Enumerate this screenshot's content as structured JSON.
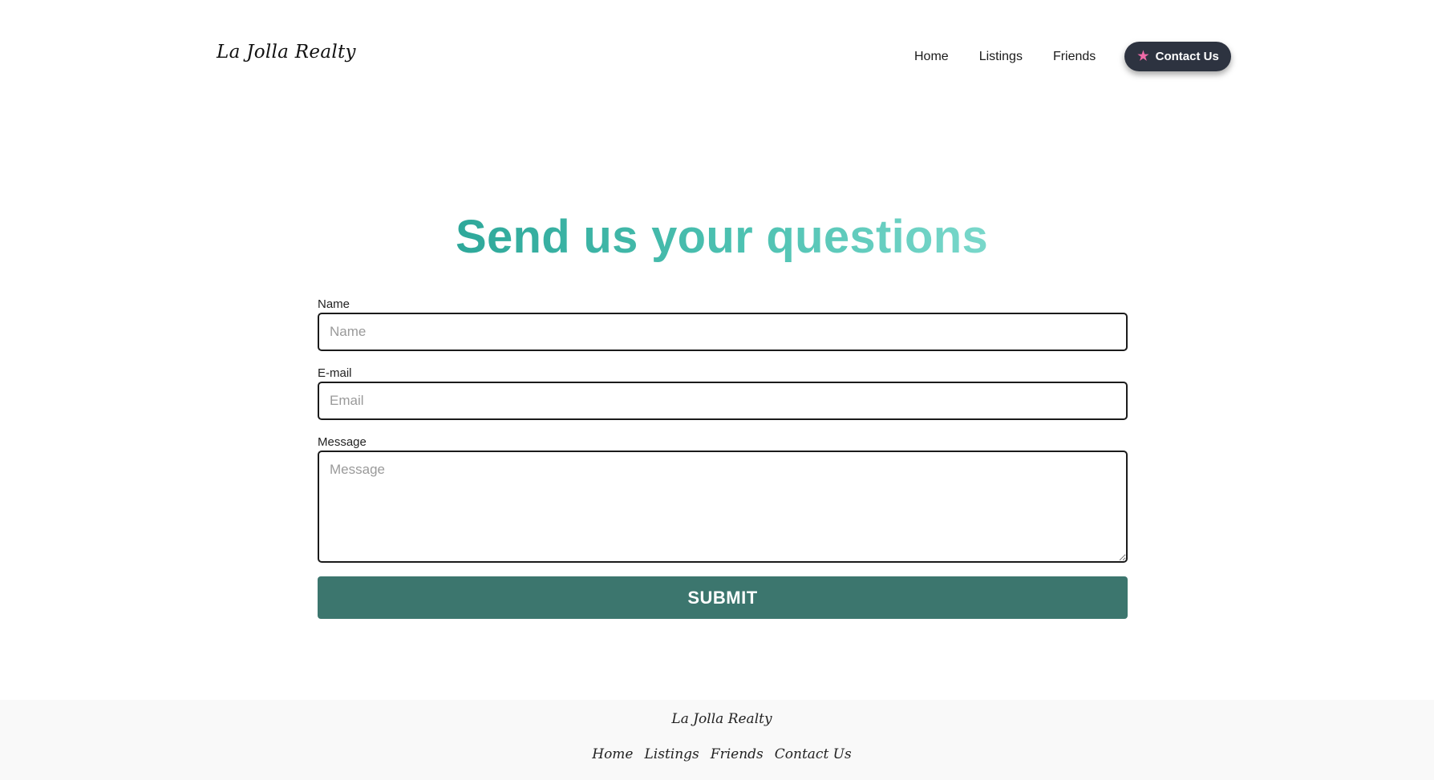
{
  "header": {
    "brand": "La Jolla Realty",
    "nav": [
      "Home",
      "Listings",
      "Friends"
    ],
    "contact_button": {
      "label": "Contact Us",
      "icon": "star-icon",
      "icon_color": "#ee6aa7",
      "background": "#2d3340"
    }
  },
  "hero": {
    "title": "Send us your questions",
    "gradient": [
      "#2ea89a",
      "#7ad8cb"
    ]
  },
  "form": {
    "name": {
      "label": "Name",
      "placeholder": "Name",
      "value": ""
    },
    "email": {
      "label": "E-mail",
      "placeholder": "Email",
      "value": ""
    },
    "message": {
      "label": "Message",
      "placeholder": "Message",
      "value": ""
    },
    "submit_label": "SUBMIT",
    "submit_color": "#3c766e"
  },
  "footer": {
    "brand": "La Jolla Realty",
    "links": [
      "Home",
      "Listings",
      "Friends",
      "Contact Us"
    ]
  }
}
